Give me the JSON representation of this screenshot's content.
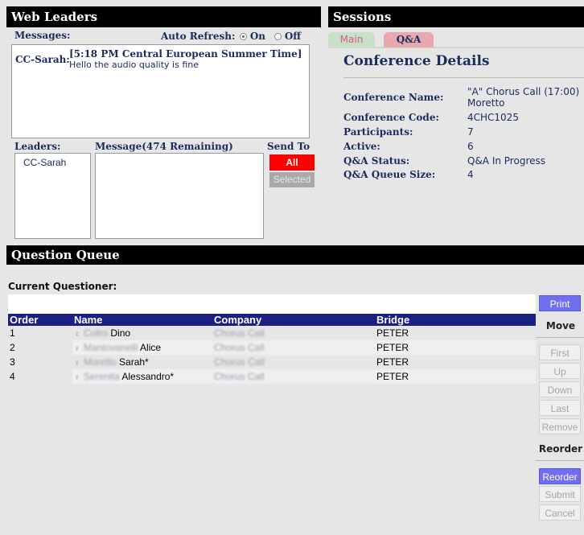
{
  "web_leaders": {
    "title": "Web Leaders",
    "messages_label": "Messages:",
    "auto_refresh_label": "Auto Refresh:",
    "on_label": "On",
    "off_label": "Off",
    "message": {
      "sender": "CC-Sarah:",
      "time": "[5:18 PM Central European Summer Time]",
      "text": "Hello the audio quality is fine"
    },
    "leaders_label": "Leaders:",
    "message_label": "Message(474 Remaining)",
    "send_to_label": "Send To",
    "leaders": [
      "CC-Sarah"
    ],
    "send_all_label": "All",
    "send_selected_label": "Selected"
  },
  "sessions": {
    "title": "Sessions",
    "tabs": [
      {
        "label": "Main"
      },
      {
        "label": "Q&A"
      }
    ],
    "details_title": "Conference Details",
    "fields": [
      {
        "label": "Conference Name:",
        "value": "\"A\" Chorus Call (17:00) Moretto"
      },
      {
        "label": "Conference Code:",
        "value": "4CHC1025"
      },
      {
        "label": "Participants:",
        "value": "7"
      },
      {
        "label": "Active:",
        "value": "6"
      },
      {
        "label": "Q&A Status:",
        "value": "Q&A In Progress"
      },
      {
        "label": "Q&A Queue Size:",
        "value": "4"
      }
    ]
  },
  "question_queue": {
    "title": "Question Queue",
    "current_questioner_label": "Current Questioner:",
    "columns": [
      "Order",
      "Name",
      "Company",
      "Bridge"
    ],
    "rows": [
      {
        "order": "1",
        "name_blurred": "Colini",
        "name": "Dino",
        "company": "Chorus Call",
        "bridge": "PETER"
      },
      {
        "order": "2",
        "name_blurred": "Mantovanelli",
        "name": "Alice",
        "company": "Chorus Call",
        "bridge": "PETER"
      },
      {
        "order": "3",
        "name_blurred": "Moretto",
        "name": "Sarah*",
        "company": "Chorus Call",
        "bridge": "PETER"
      },
      {
        "order": "4",
        "name_blurred": "Serenita",
        "name": "Alessandro*",
        "company": "Chorus Call",
        "bridge": "PETER"
      }
    ]
  },
  "actions": {
    "print_label": "Print",
    "move_label": "Move",
    "first_label": "First",
    "up_label": "Up",
    "down_label": "Down",
    "last_label": "Last",
    "remove_label": "Remove",
    "reorder_heading": "Reorder",
    "reorder_label": "Reorder",
    "submit_label": "Submit",
    "cancel_label": "Cancel"
  },
  "colors": {
    "header_bg": "#000000",
    "label_navy": "#1a2b5e",
    "send_all_bg": "#ff0000",
    "table_header_bg": "#1c2080",
    "active_button_bg": "#6f6ff0",
    "tab_bg": "#c8e0c8",
    "tab_text": "#d04060"
  }
}
